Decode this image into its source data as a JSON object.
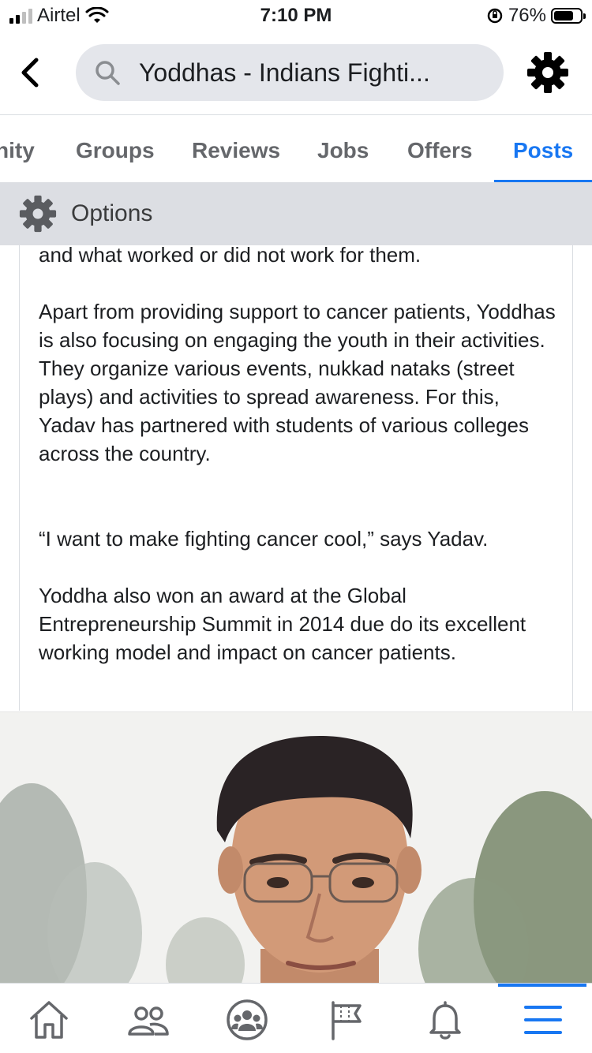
{
  "status_bar": {
    "carrier": "Airtel",
    "time": "7:10 PM",
    "battery": "76%",
    "battery_level": 0.76
  },
  "header": {
    "search_text": "Yoddhas - Indians Fighti..."
  },
  "tabs": [
    {
      "label": "nity"
    },
    {
      "label": "Groups"
    },
    {
      "label": "Reviews"
    },
    {
      "label": "Jobs"
    },
    {
      "label": "Offers"
    },
    {
      "label": "Posts",
      "active": true
    }
  ],
  "options": {
    "label": "Options"
  },
  "article": {
    "paragraphs": [
      "and what worked or did not work for them.",
      "Apart from providing support to cancer patients, Yoddhas is also focusing on engaging the youth in their activities. They organize various events, nukkad nataks (street plays) and activities to spread awareness. For this, Yadav has partnered with students of various colleges across the country.",
      "“I want to make fighting cancer cool,” says Yadav.",
      "Yoddha also won an award at the Global Entrepreneurship Summit in 2014 due do its excellent working model and impact on cancer patients."
    ]
  },
  "bottom_nav": {
    "items": [
      "home-icon",
      "friends-icon",
      "groups-icon",
      "pages-flag-icon",
      "notifications-bell-icon",
      "menu-icon"
    ],
    "active": "menu-icon"
  },
  "colors": {
    "accent": "#1877f2",
    "options_bg": "#dcdee3",
    "search_bg": "#e4e6eb",
    "inactive_tab": "#65676b"
  }
}
